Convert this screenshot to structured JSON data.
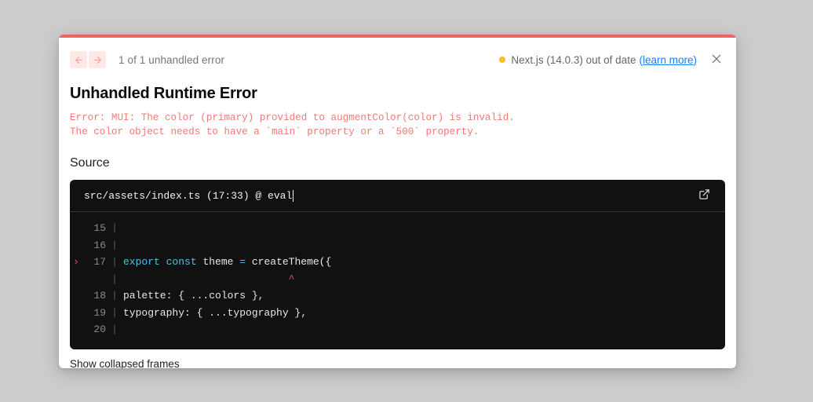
{
  "overlay": {
    "top_accent_color": "#ef6461",
    "nav": {
      "prev_icon": "arrow-left-icon",
      "next_icon": "arrow-right-icon"
    },
    "error_count_label": "1 of 1 unhandled error",
    "version": {
      "status_dot_color": "#fcbf1e",
      "text": "Next.js (14.0.3) out of date",
      "learn_more_label": "(learn more)"
    },
    "close_icon": "close-icon",
    "title": "Unhandled Runtime Error",
    "message": "Error: MUI: The color (primary) provided to augmentColor(color) is invalid.\nThe color object needs to have a `main` property or a `500` property.",
    "message_color": "#f07a76"
  },
  "source": {
    "section_label": "Source",
    "file_header": "src/assets/index.ts (17:33) @ eval",
    "open_external_icon": "external-link-icon",
    "lines": [
      {
        "num": "15",
        "marked": false,
        "segments": []
      },
      {
        "num": "16",
        "marked": false,
        "segments": []
      },
      {
        "num": "17",
        "marked": true,
        "segments": [
          {
            "t": "export",
            "c": "tok-kw"
          },
          {
            "t": " ",
            "c": "tok-pun"
          },
          {
            "t": "const",
            "c": "tok-kw"
          },
          {
            "t": " theme ",
            "c": "tok-pun"
          },
          {
            "t": "=",
            "c": "tok-op"
          },
          {
            "t": " createTheme({",
            "c": "tok-pun"
          }
        ]
      },
      {
        "num": "",
        "marked": false,
        "caret": "                           ^",
        "is_caret": true
      },
      {
        "num": "18",
        "marked": false,
        "segments": [
          {
            "t": "palette: { ...colors }",
            "c": "tok-pun"
          },
          {
            "t": ",",
            "c": "tok-comma"
          }
        ]
      },
      {
        "num": "19",
        "marked": false,
        "segments": [
          {
            "t": "typography: { ...typography }",
            "c": "tok-pun"
          },
          {
            "t": ",",
            "c": "tok-comma"
          }
        ]
      },
      {
        "num": "20",
        "marked": false,
        "segments": []
      }
    ]
  },
  "footer": {
    "collapsed_frames_label": "Show collapsed frames"
  }
}
